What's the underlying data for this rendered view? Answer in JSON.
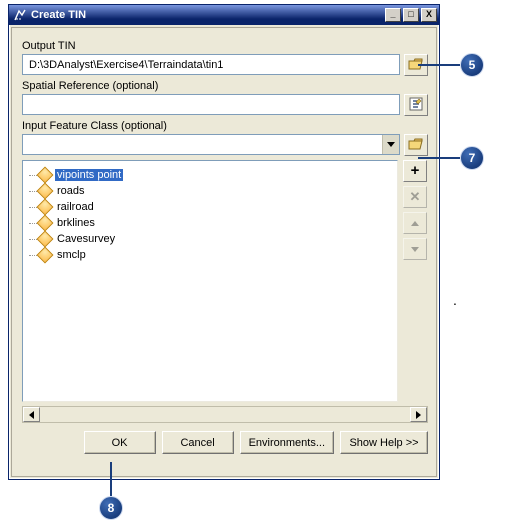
{
  "window": {
    "title": "Create TIN",
    "min": "_",
    "max": "□",
    "close": "X"
  },
  "labels": {
    "output_tin": "Output TIN",
    "spatial_ref": "Spatial Reference (optional)",
    "input_fc": "Input Feature Class (optional)"
  },
  "fields": {
    "output_tin_value": "D:\\3DAnalyst\\Exercise4\\Terraindata\\tin1",
    "spatial_ref_value": "",
    "input_fc_value": ""
  },
  "tree": {
    "items": [
      {
        "label": "vipoints point",
        "selected": true
      },
      {
        "label": "roads",
        "selected": false
      },
      {
        "label": "railroad",
        "selected": false
      },
      {
        "label": "brklines",
        "selected": false
      },
      {
        "label": "Cavesurvey",
        "selected": false
      },
      {
        "label": "smclp",
        "selected": false
      }
    ]
  },
  "buttons": {
    "ok": "OK",
    "cancel": "Cancel",
    "env": "Environments...",
    "help": "Show Help >>"
  },
  "callouts": {
    "c5": "5",
    "c7": "7",
    "c8": "8"
  }
}
